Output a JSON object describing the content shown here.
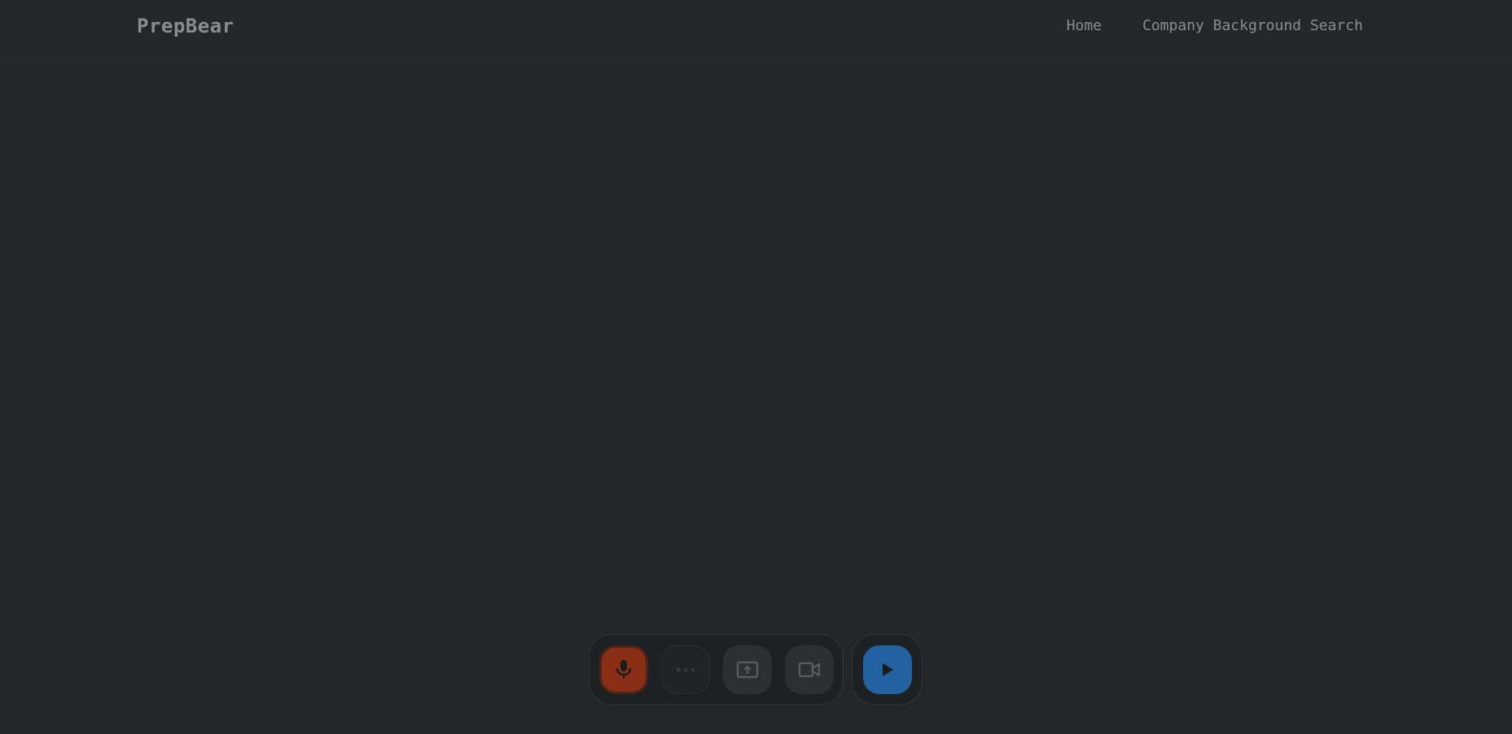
{
  "navbar": {
    "brand": "PrepBear",
    "links": [
      {
        "label": "Home"
      },
      {
        "label": "Company Background Search"
      }
    ]
  },
  "controls": {
    "buttons": [
      {
        "icon": "microphone-icon",
        "state": "active",
        "color": "#8a2f15"
      },
      {
        "icon": "more-dots-icon",
        "state": "disabled"
      },
      {
        "icon": "screen-share-icon",
        "state": "inactive"
      },
      {
        "icon": "video-camera-icon",
        "state": "inactive"
      }
    ],
    "play": {
      "icon": "play-icon",
      "color": "#2262a0"
    }
  },
  "colors": {
    "background": "#23272a",
    "text": "#8a8d8f"
  }
}
